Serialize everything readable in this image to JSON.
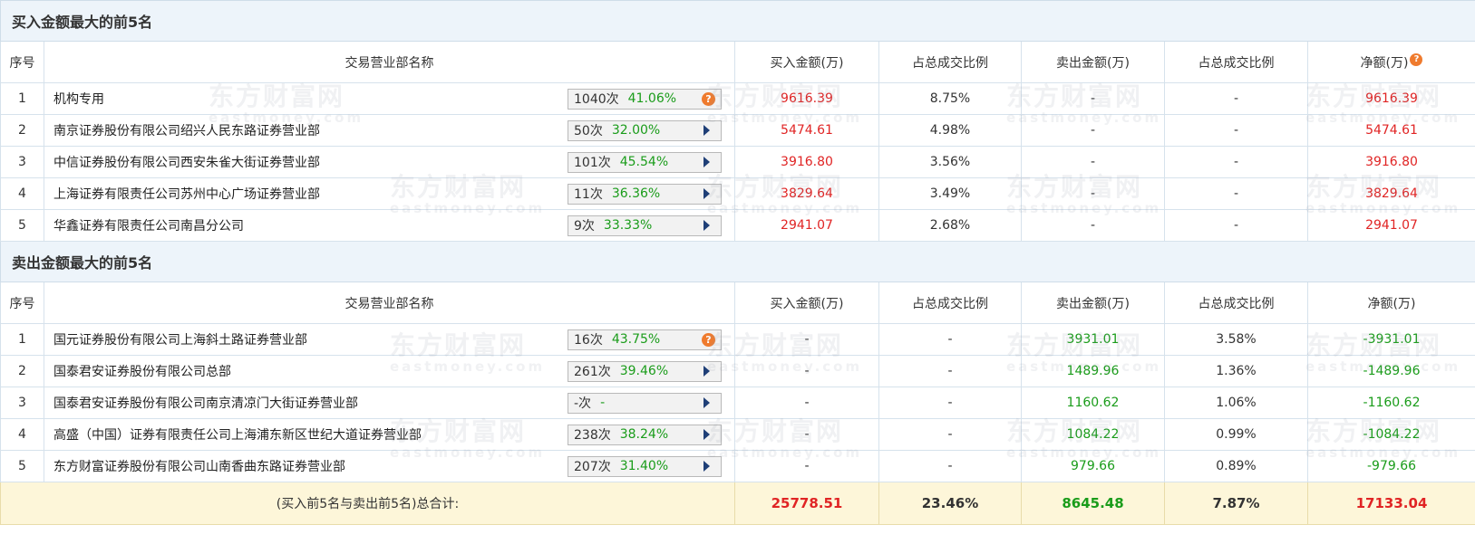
{
  "buy_section": {
    "title": "买入金额最大的前5名",
    "headers": {
      "seq": "序号",
      "name": "交易营业部名称",
      "buy": "买入金额(万)",
      "buy_ratio": "占总成交比例",
      "sell": "卖出金额(万)",
      "sell_ratio": "占总成交比例",
      "net": "净额(万)"
    },
    "rows": [
      {
        "seq": "1",
        "name": "机构专用",
        "count": "1040次",
        "rate": "41.06%",
        "action": "help",
        "buy": "9616.39",
        "buy_ratio": "8.75%",
        "sell": "-",
        "sell_ratio": "-",
        "net": "9616.39"
      },
      {
        "seq": "2",
        "name": "南京证券股份有限公司绍兴人民东路证券营业部",
        "count": "50次",
        "rate": "32.00%",
        "action": "expand",
        "buy": "5474.61",
        "buy_ratio": "4.98%",
        "sell": "-",
        "sell_ratio": "-",
        "net": "5474.61"
      },
      {
        "seq": "3",
        "name": "中信证券股份有限公司西安朱雀大街证券营业部",
        "count": "101次",
        "rate": "45.54%",
        "action": "expand",
        "buy": "3916.80",
        "buy_ratio": "3.56%",
        "sell": "-",
        "sell_ratio": "-",
        "net": "3916.80"
      },
      {
        "seq": "4",
        "name": "上海证券有限责任公司苏州中心广场证券营业部",
        "count": "11次",
        "rate": "36.36%",
        "action": "expand",
        "buy": "3829.64",
        "buy_ratio": "3.49%",
        "sell": "-",
        "sell_ratio": "-",
        "net": "3829.64"
      },
      {
        "seq": "5",
        "name": "华鑫证券有限责任公司南昌分公司",
        "count": "9次",
        "rate": "33.33%",
        "action": "expand",
        "buy": "2941.07",
        "buy_ratio": "2.68%",
        "sell": "-",
        "sell_ratio": "-",
        "net": "2941.07"
      }
    ]
  },
  "sell_section": {
    "title": "卖出金额最大的前5名",
    "headers": {
      "seq": "序号",
      "name": "交易营业部名称",
      "buy": "买入金额(万)",
      "buy_ratio": "占总成交比例",
      "sell": "卖出金额(万)",
      "sell_ratio": "占总成交比例",
      "net": "净额(万)"
    },
    "rows": [
      {
        "seq": "1",
        "name": "国元证券股份有限公司上海斜土路证券营业部",
        "count": "16次",
        "rate": "43.75%",
        "action": "help",
        "buy": "-",
        "buy_ratio": "-",
        "sell": "3931.01",
        "sell_ratio": "3.58%",
        "net": "-3931.01"
      },
      {
        "seq": "2",
        "name": "国泰君安证券股份有限公司总部",
        "count": "261次",
        "rate": "39.46%",
        "action": "expand",
        "buy": "-",
        "buy_ratio": "-",
        "sell": "1489.96",
        "sell_ratio": "1.36%",
        "net": "-1489.96"
      },
      {
        "seq": "3",
        "name": "国泰君安证券股份有限公司南京清凉门大街证券营业部",
        "count": "-次",
        "rate": "-",
        "action": "expand",
        "buy": "-",
        "buy_ratio": "-",
        "sell": "1160.62",
        "sell_ratio": "1.06%",
        "net": "-1160.62"
      },
      {
        "seq": "4",
        "name": "高盛（中国）证券有限责任公司上海浦东新区世纪大道证券营业部",
        "count": "238次",
        "rate": "38.24%",
        "action": "expand",
        "buy": "-",
        "buy_ratio": "-",
        "sell": "1084.22",
        "sell_ratio": "0.99%",
        "net": "-1084.22"
      },
      {
        "seq": "5",
        "name": "东方财富证券股份有限公司山南香曲东路证券营业部",
        "count": "207次",
        "rate": "31.40%",
        "action": "expand",
        "buy": "-",
        "buy_ratio": "-",
        "sell": "979.66",
        "sell_ratio": "0.89%",
        "net": "-979.66"
      }
    ]
  },
  "total": {
    "label": "(买入前5名与卖出前5名)总合计:",
    "buy": "25778.51",
    "buy_ratio": "23.46%",
    "sell": "8645.48",
    "sell_ratio": "7.87%",
    "net": "17133.04"
  },
  "watermark": {
    "cn": "东方财富网",
    "en": "eastmoney.com"
  },
  "colors": {
    "positive": "#e02424",
    "negative": "#1a9c1a",
    "header_bg": "#edf4fa",
    "total_bg": "#fdf6d9",
    "help_icon": "#ef7b2e",
    "expand_arrow": "#1f3f77"
  },
  "icons": {
    "help": "question-circle-icon",
    "expand": "triangle-right-icon"
  }
}
